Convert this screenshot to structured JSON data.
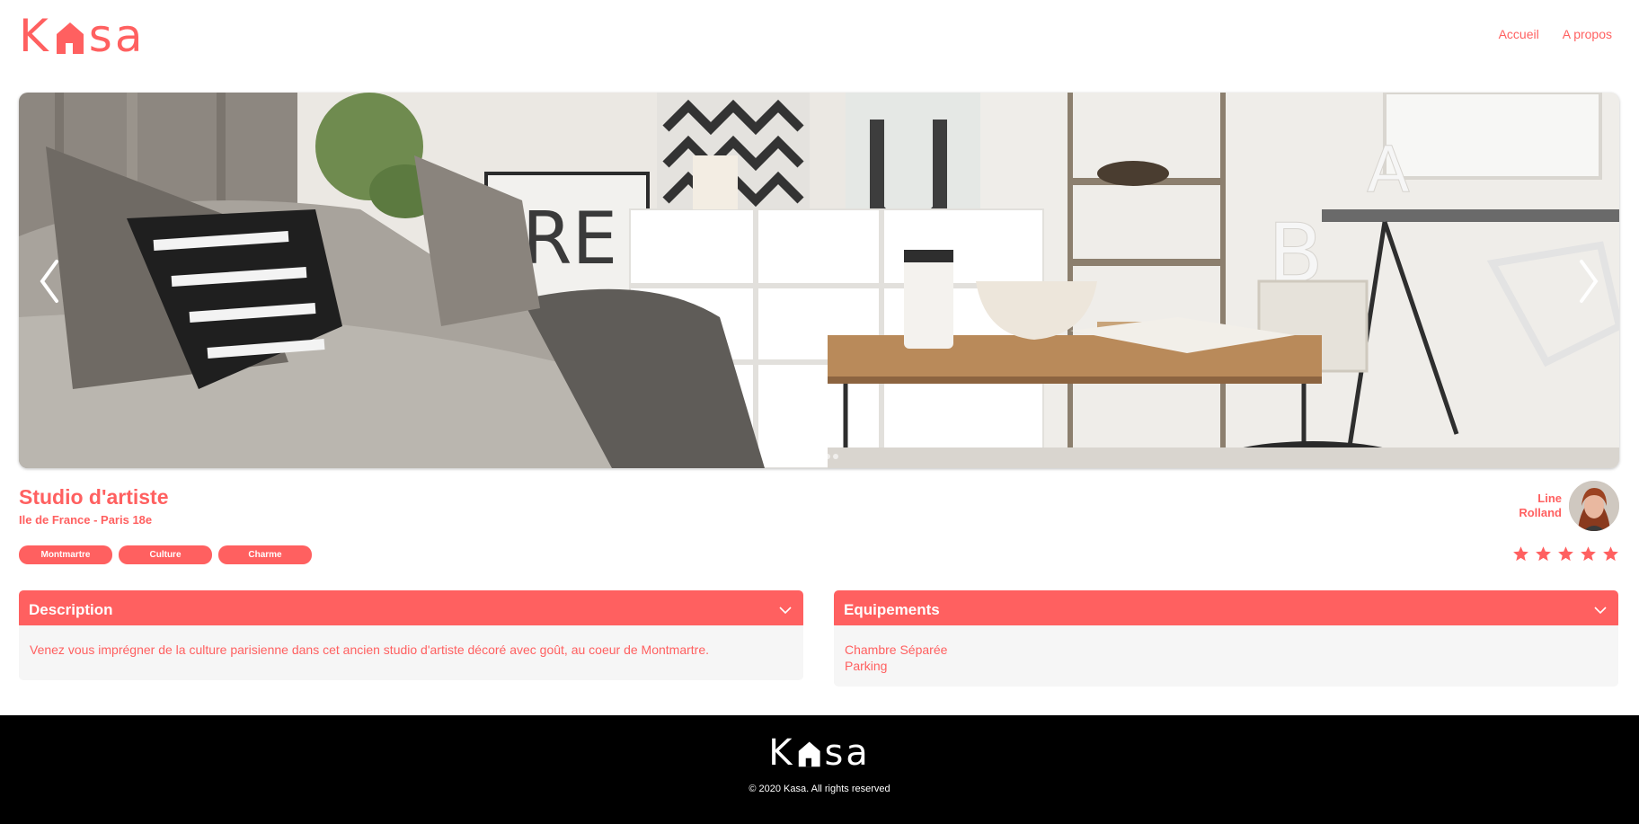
{
  "brand": {
    "logo_left": "K",
    "logo_right": "sa",
    "accent_color": "#FF6060",
    "logo_icon": "house-icon"
  },
  "nav": {
    "items": [
      {
        "label": "Accueil"
      },
      {
        "label": "A propos"
      }
    ]
  },
  "carousel": {
    "prev_icon": "chevron-left-icon",
    "next_icon": "chevron-right-icon",
    "slide_count": 5,
    "active_slide": 3
  },
  "listing": {
    "title": "Studio d'artiste",
    "location": "Ile de France - Paris 18e",
    "tags": [
      "Montmartre",
      "Culture",
      "Charme"
    ],
    "host": {
      "first_name": "Line",
      "last_name": "Rolland"
    },
    "rating": 5,
    "rating_max": 5
  },
  "description": {
    "title": "Description",
    "text": "Venez vous imprégner de la culture parisienne dans cet ancien studio d'artiste décoré avec goût, au coeur de Montmartre."
  },
  "equipements": {
    "title": "Equipements",
    "items": [
      "Chambre Séparée",
      "Parking"
    ]
  },
  "footer": {
    "logo_left": "K",
    "logo_right": "sa",
    "copyright": "© 2020 Kasa. All rights reserved"
  }
}
